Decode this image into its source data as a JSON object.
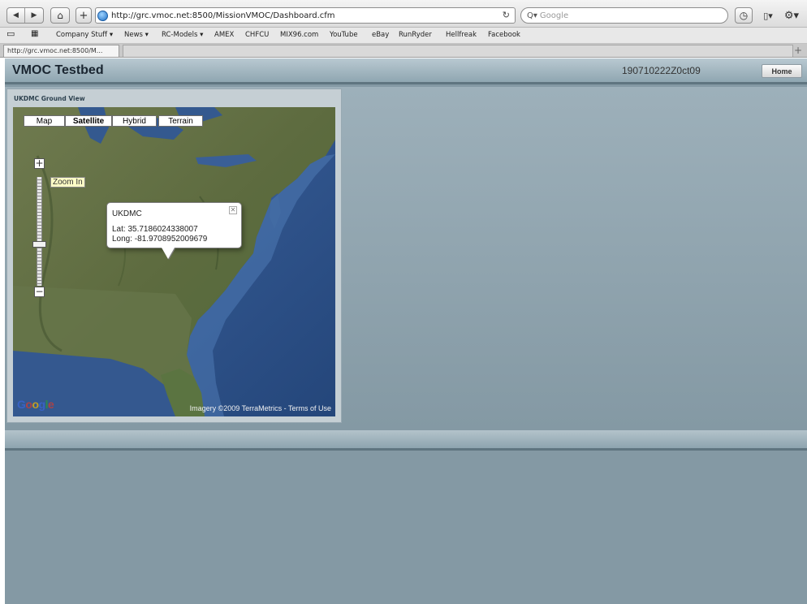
{
  "browser": {
    "url": "http://grc.vmoc.net:8500/MissionVMOC/Dashboard.cfm",
    "search_placeholder": "Google",
    "bookmarks": [
      "Company Stuff ▾",
      "News ▾",
      "RC-Models ▾",
      "AMEX",
      "CHFCU",
      "MIX96.com",
      "YouTube",
      "eBay",
      "RunRyder",
      "Hellfreak",
      "Facebook"
    ],
    "tab_title": "http://grc.vmoc.net:8500/M..."
  },
  "app": {
    "title": "VMOC Testbed",
    "dtg": "190710222Z0ct09",
    "home_label": "Home"
  },
  "panel": {
    "title": "UKDMC Ground View"
  },
  "map": {
    "types": [
      "Map",
      "Satellite",
      "Hybrid",
      "Terrain"
    ],
    "selected_type": "Satellite",
    "zoom_tooltip": "Zoom In",
    "zoom_level": 0.62,
    "info": {
      "title": "UKDMC",
      "lat": "Lat: 35.7186024338007",
      "long": "Long: -81.9708952009679"
    },
    "logo": "Google",
    "attribution": "Imagery ©2009 TerraMetrics - Terms of Use"
  },
  "colors": {
    "page_bg": "#8499a4",
    "header_bg": "#a9bcc5"
  }
}
